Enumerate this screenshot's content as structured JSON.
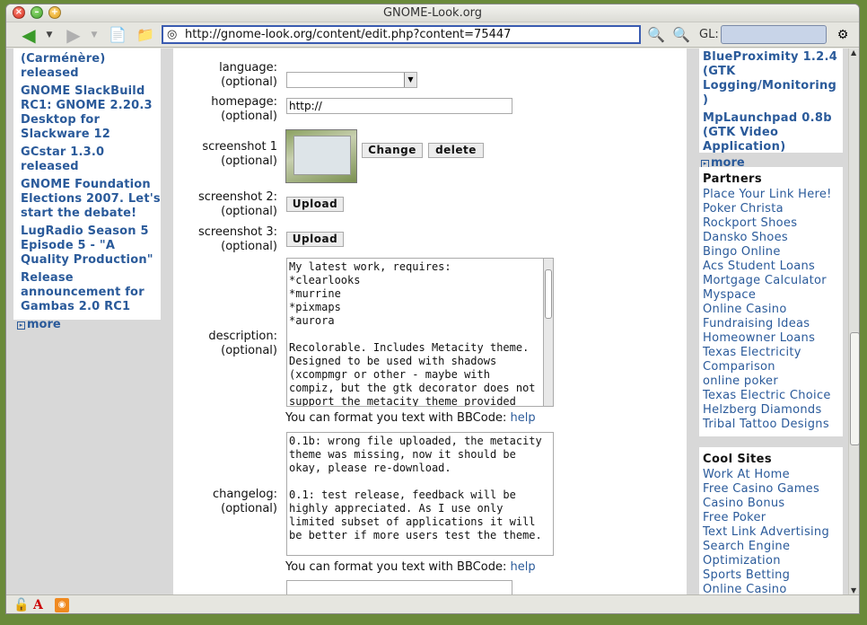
{
  "window": {
    "title": "GNOME-Look.org"
  },
  "toolbar": {
    "url": "http://gnome-look.org/content/edit.php?content=75447",
    "search_label": "GL:"
  },
  "left_news": {
    "items": [
      "(Carménère) released",
      "GNOME SlackBuild RC1: GNOME 2.20.3 Desktop for Slackware 12",
      "GCstar 1.3.0 released",
      "GNOME Foundation Elections 2007. Let's start the debate!",
      "LugRadio Season 5 Episode 5 - \"A Quality Production\"",
      "Release announcement for Gambas 2.0 RC1"
    ],
    "more": "more"
  },
  "form": {
    "language_label": "language:",
    "homepage_label": "homepage:",
    "homepage_value": "http://",
    "screenshot1_label": "screenshot 1",
    "screenshot2_label": "screenshot 2:",
    "screenshot3_label": "screenshot 3:",
    "optional": "(optional)",
    "change_button": "Change",
    "delete_button": "delete",
    "upload_button": "Upload",
    "description_label": "description:",
    "description_text": "My latest work, requires:\n*clearlooks\n*murrine\n*pixmaps\n*aurora\n\nRecolorable. Includes Metacity theme. Designed to be used with shadows (xcompmgr or other - maybe with compiz, but the gtk decorator does not support the metacity theme provided with this",
    "changelog_label": "changelog:",
    "changelog_text": "0.1b: wrong file uploaded, the metacity theme was missing, now it should be okay, please re-download.\n\n0.1: test release, feedback will be highly appreciated. As I use only limited subset of applications it will be better if more users test the theme.",
    "bbcode_hint": "You can format you text with BBCode:",
    "help_link": "help"
  },
  "right_top": {
    "items": [
      "BlueProximity 1.2.4 (GTK Logging/Monitoring )",
      "MpLaunchpad 0.8b (GTK Video Application)"
    ],
    "more": "more"
  },
  "partners": {
    "title": "Partners",
    "links": [
      "Place Your Link Here!",
      "Poker Christa",
      "Rockport Shoes Dansko Shoes",
      "Bingo Online",
      "Acs Student Loans",
      "Mortgage Calculator",
      "Myspace",
      "Online Casino",
      "Fundraising Ideas",
      "Homeowner Loans",
      "Texas Electricity Comparison",
      "online poker",
      "Texas Electric Choice",
      "Helzberg Diamonds",
      "Tribal Tattoo Designs"
    ]
  },
  "cool_sites": {
    "title": "Cool Sites",
    "links": [
      "Work At Home",
      "Free Casino Games",
      "Casino Bonus",
      "Free Poker",
      "Text Link Advertising",
      "Search Engine Optimization",
      "Sports Betting",
      "Online Casino"
    ]
  }
}
